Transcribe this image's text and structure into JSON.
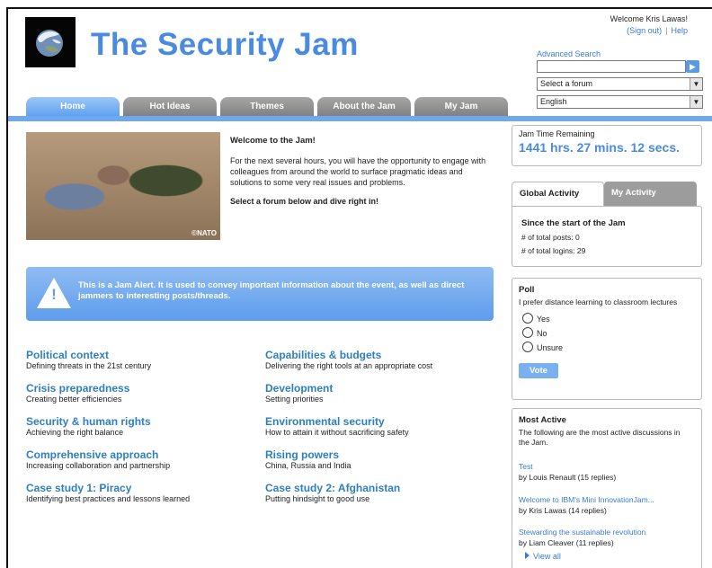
{
  "header": {
    "title": "The Security Jam",
    "welcome": "Welcome Kris Lawas!",
    "sign_out": "(Sign out)",
    "separator": "|",
    "help": "Help",
    "advanced_search": "Advanced Search",
    "search_value": "",
    "forum_select": "Select a forum",
    "language_select": "English"
  },
  "tabs": [
    "Home",
    "Hot Ideas",
    "Themes",
    "About the Jam",
    "My Jam"
  ],
  "hero": {
    "image_credit": "©NATO",
    "heading": "Welcome to the Jam!",
    "body": "For the next several hours, you will have the opportunity to engage with colleagues from around the world to surface pragmatic ideas and solutions to some very real issues and problems.",
    "cta": "Select a forum below and dive right in!"
  },
  "alert": {
    "text": "This is a Jam Alert. It is used to convey important information about the event, as well as direct jammers to interesting posts/threads."
  },
  "forums": [
    {
      "title": "Political context",
      "desc": "Defining threats in the 21st century"
    },
    {
      "title": "Capabilities & budgets",
      "desc": "Delivering the right tools at an appropriate cost"
    },
    {
      "title": "Crisis preparedness",
      "desc": "Creating better efficiencies"
    },
    {
      "title": "Development",
      "desc": "Setting priorities"
    },
    {
      "title": "Security & human rights",
      "desc": "Achieving the right balance"
    },
    {
      "title": "Environmental security",
      "desc": "How to attain it without sacrificing safety"
    },
    {
      "title": "Comprehensive approach",
      "desc": "Increasing collaboration and partnership"
    },
    {
      "title": "Rising powers",
      "desc": "China, Russia and India"
    },
    {
      "title": "Case study 1: Piracy",
      "desc": "Identifying best practices and lessons learned"
    },
    {
      "title": "Case study 2: Afghanistan",
      "desc": "Putting hindsight to good use"
    }
  ],
  "jam_time": {
    "label": "Jam Time Remaining",
    "value": "1441 hrs. 27 mins. 12 secs."
  },
  "activity": {
    "tab_global": "Global Activity",
    "tab_mine": "My Activity",
    "heading": "Since the start of the Jam",
    "posts": "# of total posts: 0",
    "logins": "# of total logins: 29"
  },
  "poll": {
    "heading": "Poll",
    "question": "I prefer distance learning to classroom lectures",
    "options": [
      "Yes",
      "No",
      "Unsure"
    ],
    "vote": "Vote"
  },
  "most_active": {
    "heading": "Most Active",
    "intro": "The following are the most active discussions in the Jam.",
    "items": [
      {
        "title": "Test",
        "by": "by Louis Renault (15 replies)"
      },
      {
        "title": "Welcome to IBM's Mini InnovationJam...",
        "by": "by Kris Lawas (14 replies)"
      },
      {
        "title": "Stewarding the sustainable revolution",
        "by": "by Liam Cleaver (11 replies)"
      }
    ],
    "view_all": "View all"
  },
  "colors": {
    "brand_blue": "#4a8be0",
    "link_blue": "#2e7fbf",
    "nav_bar": "#6ea9ef",
    "tab_inactive": "#8f8f8f"
  }
}
